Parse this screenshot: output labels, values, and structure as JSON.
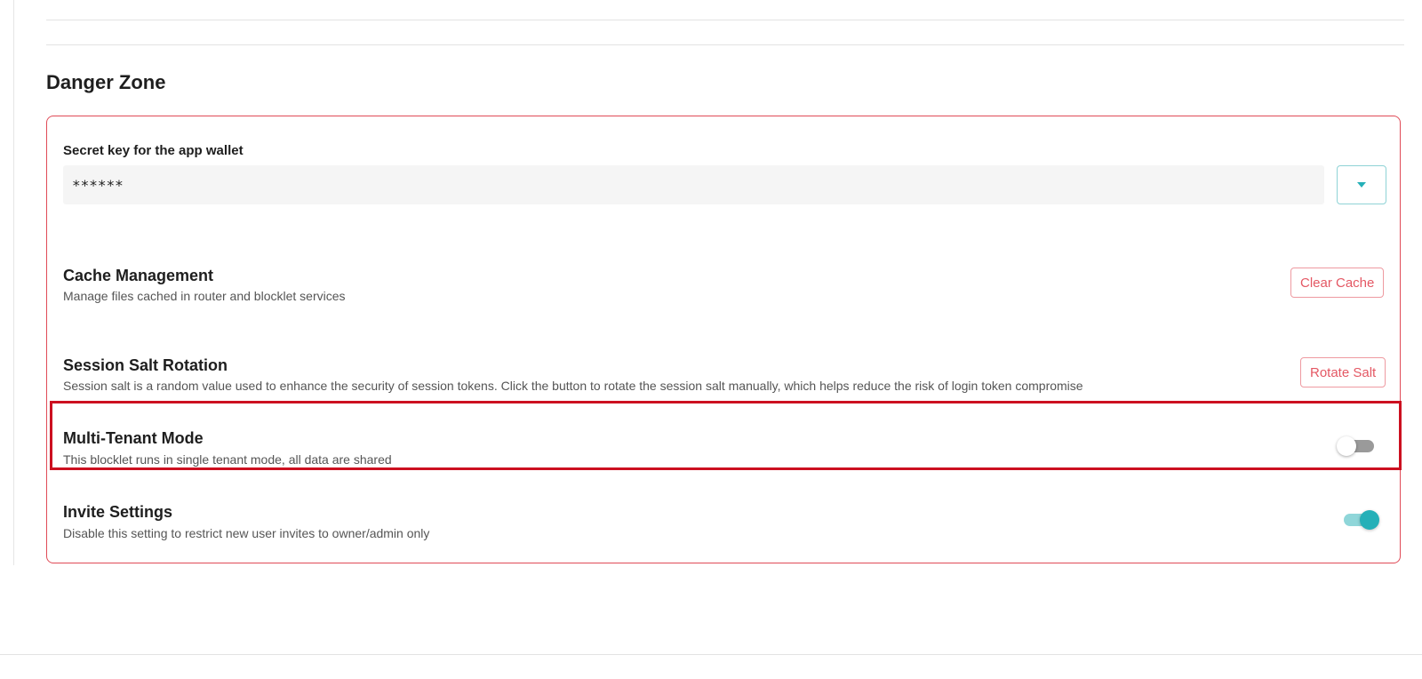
{
  "section": {
    "title": "Danger Zone"
  },
  "secret_key": {
    "label": "Secret key for the app wallet",
    "value": "******"
  },
  "cache": {
    "title": "Cache Management",
    "description": "Manage files cached in router and blocklet services",
    "button_label": "Clear Cache"
  },
  "session_salt": {
    "title": "Session Salt Rotation",
    "description": "Session salt is a random value used to enhance the security of session tokens. Click the button to rotate the session salt manually, which helps reduce the risk of login token compromise",
    "button_label": "Rotate Salt"
  },
  "multi_tenant": {
    "title": "Multi-Tenant Mode",
    "description": "This blocklet runs in single tenant mode, all data are shared",
    "enabled": false
  },
  "invite": {
    "title": "Invite Settings",
    "description": "Disable this setting to restrict new user invites to owner/admin only",
    "enabled": true
  },
  "icons": {
    "dropdown": "chevron-down-icon"
  },
  "colors": {
    "danger": "#e04b57",
    "accent": "#25b0b8",
    "highlight": "#cc1020"
  }
}
